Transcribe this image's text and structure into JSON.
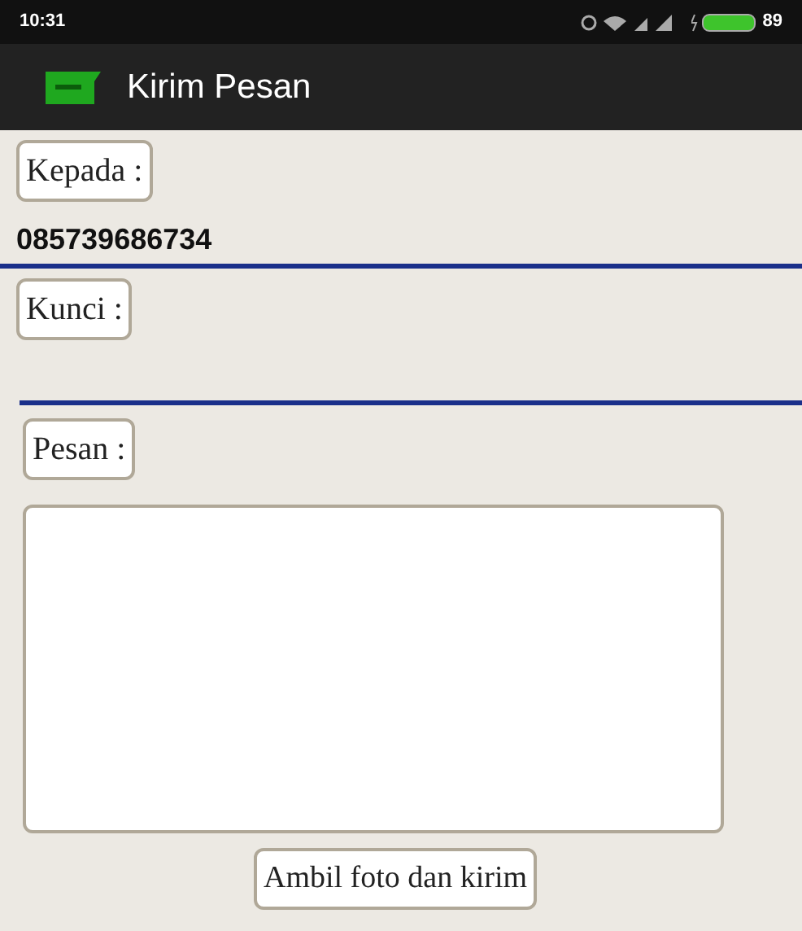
{
  "status_bar": {
    "time": "10:31",
    "battery": "89"
  },
  "app_bar": {
    "title": "Kirim Pesan"
  },
  "recipient": {
    "label": "Kepada :",
    "value": "085739686734"
  },
  "key": {
    "label": "Kunci  :"
  },
  "message": {
    "label": "Pesan  :"
  },
  "button": "Ambil foto dan kirim"
}
